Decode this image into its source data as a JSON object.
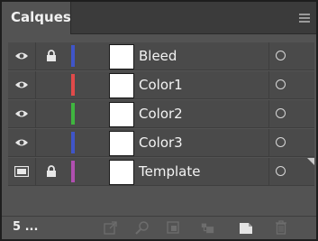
{
  "panel": {
    "tab_label": "Calques",
    "menu_icon": "panel-menu-icon"
  },
  "layers": [
    {
      "name": "Bleed",
      "visible": true,
      "visibility_icon": "eye-icon",
      "locked": true,
      "color": "#3f55c8",
      "target": "circle"
    },
    {
      "name": "Color1",
      "visible": true,
      "visibility_icon": "eye-icon",
      "locked": false,
      "color": "#e04a4a",
      "target": "circle"
    },
    {
      "name": "Color2",
      "visible": true,
      "visibility_icon": "eye-icon",
      "locked": false,
      "color": "#3fb53f",
      "target": "circle"
    },
    {
      "name": "Color3",
      "visible": true,
      "visibility_icon": "eye-icon",
      "locked": false,
      "color": "#3f55c8",
      "target": "circle"
    },
    {
      "name": "Template",
      "visible": true,
      "visibility_icon": "template-icon",
      "locked": true,
      "color": "#b04fb0",
      "target": "circle"
    }
  ],
  "footer": {
    "count_text": "5 ...",
    "icons": [
      "export-icon",
      "locate-object-icon",
      "clipping-mask-icon",
      "new-sublayer-icon",
      "new-layer-icon",
      "delete-icon"
    ]
  }
}
